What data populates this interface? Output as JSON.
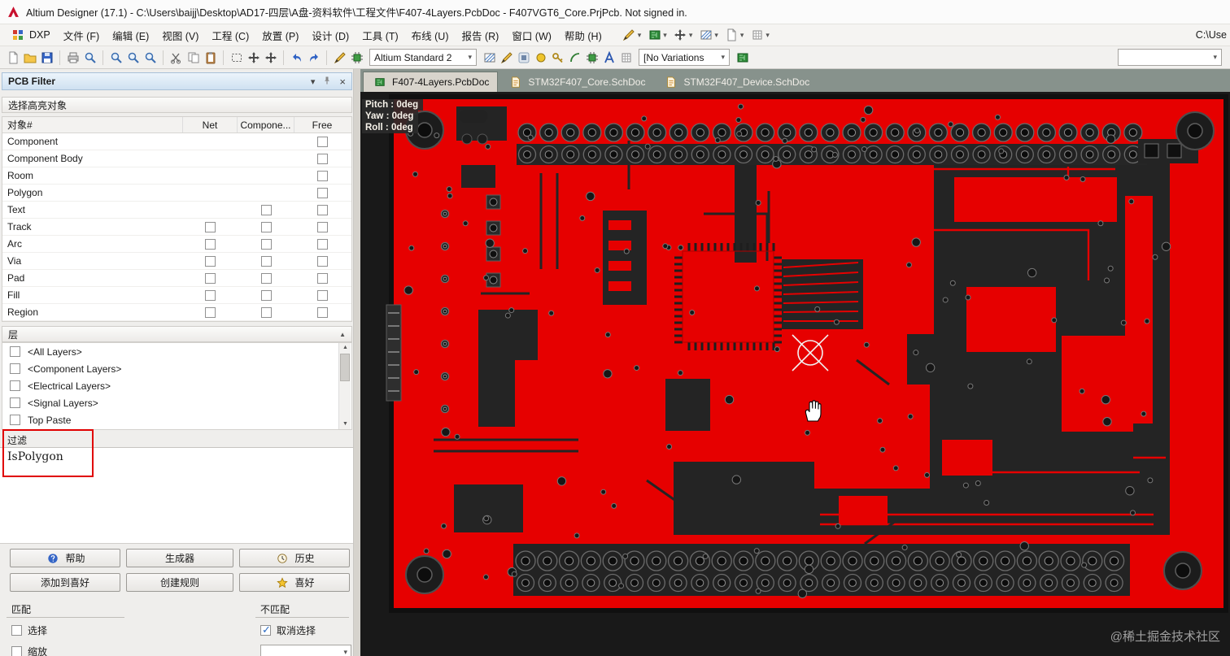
{
  "window": {
    "title": "Altium Designer (17.1) - C:\\Users\\baijj\\Desktop\\AD17-四层\\A盘-资料软件\\工程文件\\F407-4Layers.PcbDoc - F407VGT6_Core.PrjPcb. Not signed in."
  },
  "menu": {
    "items": [
      "DXP",
      "文件 (F)",
      "编辑 (E)",
      "视图 (V)",
      "工程 (C)",
      "放置 (P)",
      "设计 (D)",
      "工具 (T)",
      "布线 (U)",
      "报告 (R)",
      "窗口 (W)",
      "帮助 (H)"
    ],
    "item_names": [
      "dxp",
      "file",
      "edit",
      "view",
      "project",
      "place",
      "design",
      "tools",
      "route",
      "reports",
      "window",
      "help"
    ],
    "icon_names": [
      "wire-tool-icon",
      "board-insight-icon",
      "cross-probe-icon",
      "measure-icon",
      "sheet-icon",
      "snap-grid-icon"
    ],
    "right_text": "C:\\Use"
  },
  "toolbar": {
    "style_combo": "Altium Standard 2",
    "variations_combo": "[No Variations",
    "left_icons": [
      "new-document-icon",
      "open-document-icon",
      "save-document-icon",
      "sep",
      "print-icon",
      "print-preview-icon",
      "sep",
      "zoom-fit-icon",
      "zoom-area-icon",
      "zoom-selected-icon",
      "sep",
      "cut-icon",
      "copy-icon",
      "paste-icon",
      "sep",
      "select-area-icon",
      "move-selection-icon",
      "offset-icon",
      "sep",
      "undo-icon",
      "redo-icon",
      "sep",
      "interactive-routing-icon",
      "snippet-icon"
    ],
    "mid_icons": [
      "polygon-hatch-icon",
      "place-line-icon",
      "place-net-icon",
      "place-via-icon",
      "place-key-icon",
      "place-arc-icon",
      "place-part-icon",
      "place-string-icon",
      "snap-grid-icon"
    ],
    "variant_board_icon": "variant-board-icon"
  },
  "panel": {
    "title": "PCB Filter",
    "header_icons": [
      "caret-down-icon",
      "pin-icon",
      "close-icon"
    ],
    "section_highlight": "选择高亮对象",
    "table": {
      "headers": [
        "对象#",
        "Net",
        "Compone...",
        "Free"
      ],
      "rows": [
        {
          "label": "Component",
          "checks": {
            "net": false,
            "component": false,
            "free": true
          }
        },
        {
          "label": "Component Body",
          "checks": {
            "net": false,
            "component": false,
            "free": true
          }
        },
        {
          "label": "Room",
          "checks": {
            "net": false,
            "component": false,
            "free": true
          }
        },
        {
          "label": "Polygon",
          "checks": {
            "net": false,
            "component": false,
            "free": true
          }
        },
        {
          "label": "Text",
          "checks": {
            "net": false,
            "component": true,
            "free": true
          }
        },
        {
          "label": "Track",
          "checks": {
            "net": true,
            "component": true,
            "free": true
          }
        },
        {
          "label": "Arc",
          "checks": {
            "net": true,
            "component": true,
            "free": true
          }
        },
        {
          "label": "Via",
          "checks": {
            "net": true,
            "component": true,
            "free": true
          }
        },
        {
          "label": "Pad",
          "checks": {
            "net": true,
            "component": true,
            "free": true
          }
        },
        {
          "label": "Fill",
          "checks": {
            "net": true,
            "component": true,
            "free": true
          }
        },
        {
          "label": "Region",
          "checks": {
            "net": true,
            "component": true,
            "free": true
          }
        }
      ]
    },
    "layers_title": "层",
    "layers": [
      "<All Layers>",
      "<Component Layers>",
      "<Electrical Layers>",
      "<Signal Layers>",
      "Top Paste"
    ],
    "filter_label": "过滤",
    "filter_value": "IsPolygon",
    "buttons": [
      {
        "label": "帮助",
        "icon": "help-icon"
      },
      {
        "label": "生成器",
        "icon": ""
      },
      {
        "label": "历史",
        "icon": "history-icon"
      },
      {
        "label": "添加到喜好",
        "icon": ""
      },
      {
        "label": "创建规则",
        "icon": ""
      },
      {
        "label": "喜好",
        "icon": "star-icon"
      }
    ],
    "match": {
      "title": "匹配",
      "options": [
        {
          "label": "选择",
          "checked": false
        },
        {
          "label": "缩放",
          "checked": false
        }
      ]
    },
    "unmatch": {
      "title": "不匹配",
      "options": [
        {
          "label": "取消选择",
          "checked": true
        }
      ]
    }
  },
  "tabs": [
    {
      "label": "F407-4Layers.PcbDoc",
      "kind": "pcb",
      "active": true
    },
    {
      "label": "STM32F407_Core.SchDoc",
      "kind": "sch",
      "active": false
    },
    {
      "label": "STM32F407_Device.SchDoc",
      "kind": "sch",
      "active": false
    }
  ],
  "canvas": {
    "overlay": [
      "Pitch : 0deg",
      "Yaw : 0deg",
      "Roll : 0deg"
    ],
    "watermark": "@稀土掘金技术社区"
  },
  "colors": {
    "board_red": "#e60000",
    "canvas_bg": "#191919",
    "annotation_red": "#e00000"
  }
}
